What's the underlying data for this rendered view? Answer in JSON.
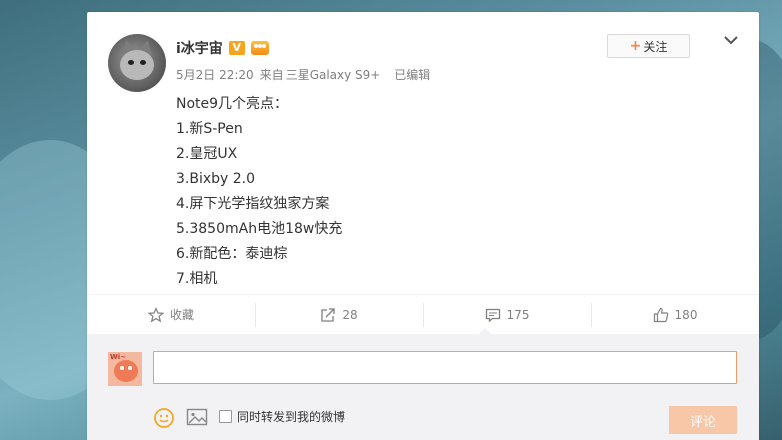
{
  "post": {
    "username": "i冰宇宙",
    "verified_badge": "V",
    "date": "5月2日 22:20",
    "source_prefix": "来自",
    "source": "三星Galaxy S9+",
    "edited": "已编辑",
    "follow_label": "关注",
    "follow_plus": "+",
    "content_lines": [
      "Note9几个亮点：",
      "1.新S-Pen",
      "2.皇冠UX",
      "3.Bixby 2.0",
      "4.屏下光学指纹独家方案",
      "5.3850mAh电池18w快充",
      "6.新配色：泰迪棕",
      "7.相机"
    ]
  },
  "actions": {
    "favorite_label": "收藏",
    "repost_count": "28",
    "comment_count": "175",
    "like_count": "180"
  },
  "comment_box": {
    "avatar_tag": "Wi~",
    "input_value": "",
    "repost_checkbox_label": "同时转发到我的微博",
    "submit_label": "评论"
  },
  "colors": {
    "accent_orange": "#ff8140",
    "submit_disabled": "#f7c7a8",
    "input_border": "#f29b6a"
  },
  "icons": [
    "star-icon",
    "repost-icon",
    "comment-icon",
    "like-icon",
    "emoji-icon",
    "image-icon",
    "chevron-down-icon",
    "verified-icon",
    "member-icon"
  ]
}
